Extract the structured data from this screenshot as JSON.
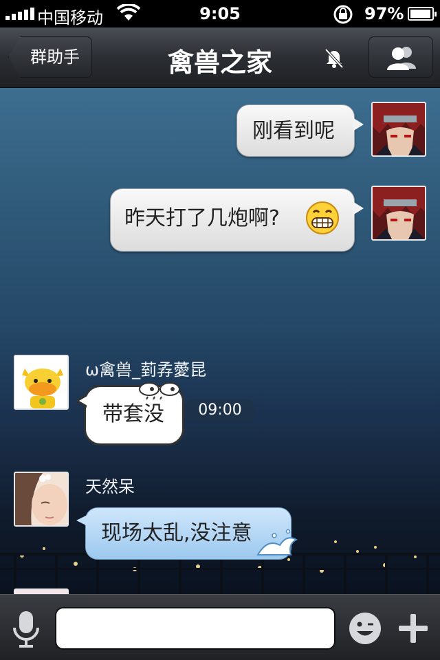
{
  "status_bar": {
    "carrier": "中国移动",
    "time": "9:05",
    "battery": "97%",
    "battery_level": 0.97,
    "icons": [
      "signal-icon",
      "wifi-icon",
      "rotation-lock-icon",
      "battery-icon"
    ]
  },
  "nav": {
    "back_label": "群助手",
    "title": "禽兽之家",
    "icons": [
      "mute-bell-icon",
      "group-members-icon"
    ]
  },
  "messages": [
    {
      "direction": "outgoing",
      "text": "刚看到呢",
      "avatar": "red-hair-anime-avatar"
    },
    {
      "direction": "outgoing",
      "text": "昨天打了几炮啊?",
      "emoji": "grin-emoji",
      "avatar": "red-hair-anime-avatar"
    },
    {
      "type": "timestamp",
      "text": "09:00"
    },
    {
      "direction": "incoming",
      "sender": "ω禽兽_菿孨薆昆",
      "text": "带套没",
      "avatar": "yellow-cow-avatar",
      "style": "comic"
    },
    {
      "direction": "incoming",
      "sender": "天然呆",
      "text": "现场太乱,没注意",
      "avatar": "girl-photo-avatar",
      "style": "blue-wave"
    }
  ],
  "input_bar": {
    "placeholder": "",
    "icons": [
      "microphone-icon",
      "emoji-icon",
      "plus-icon"
    ]
  },
  "colors": {
    "nav_bar": "#2b2e33",
    "chat_background": "#2f5978",
    "outgoing_bubble": "#ececec",
    "blue_bubble": "#b6d8f5"
  }
}
